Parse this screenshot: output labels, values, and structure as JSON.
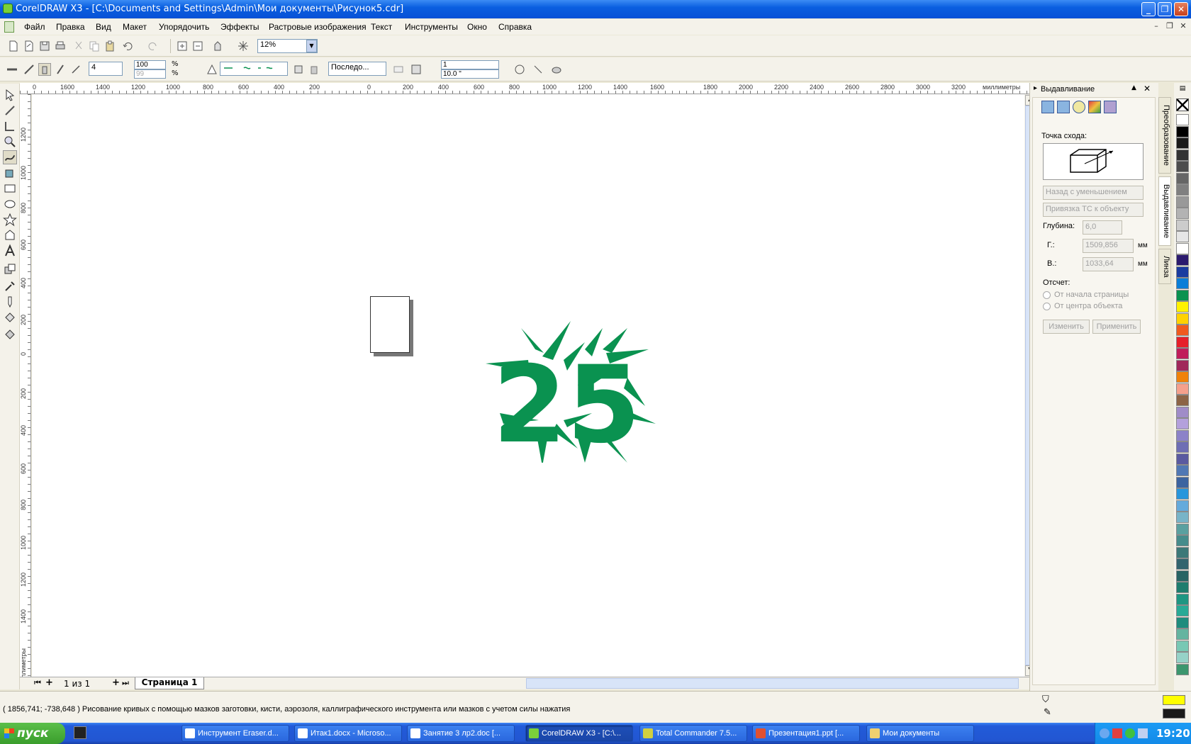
{
  "window": {
    "title": "CorelDRAW X3 - [C:\\Documents and Settings\\Admin\\Мои документы\\Рисунок5.cdr]"
  },
  "menu": [
    "Файл",
    "Правка",
    "Вид",
    "Макет",
    "Упорядочить",
    "Эффекты",
    "Растровые изображения",
    "Текст",
    "Инструменты",
    "Окно",
    "Справка"
  ],
  "toolbar1": {
    "zoom": "12%"
  },
  "toolbar2": {
    "width_value": "4",
    "size_top": "100",
    "size_bottom": "99",
    "percent1": "%",
    "percent2": "%",
    "mode_select": "Последо...",
    "spin_top": "1",
    "spin_bottom": "10.0 \""
  },
  "ruler": {
    "h_ticks": [
      "0",
      "1600",
      "1400",
      "1200",
      "1000",
      "800",
      "600",
      "400",
      "200",
      "0",
      "200",
      "400",
      "600",
      "800",
      "1000",
      "1200",
      "1400",
      "1600",
      "1800",
      "2000",
      "2200",
      "2400",
      "2600",
      "2800",
      "3000",
      "3200"
    ],
    "h_unit": "миллиметры",
    "v_ticks": [
      "1200",
      "1000",
      "800",
      "600",
      "400",
      "200",
      "0",
      "200",
      "400",
      "600",
      "800",
      "1000",
      "1200",
      "1400"
    ],
    "v_unit": "миллиметры"
  },
  "canvas": {
    "artwork_text": "25",
    "artwork_color": "#0a9250"
  },
  "pagebar": {
    "page_count": "1 из 1",
    "page_tab": "Страница 1"
  },
  "docker": {
    "title": "Выдавливание",
    "vanishing_label": "Точка схода:",
    "dropdown1": "Назад с уменьшением",
    "dropdown2": "Привязка ТС к объекту",
    "depth_label": "Глубина:",
    "depth_value": "6,0",
    "h_label": "Г.:",
    "h_value": "1509,856",
    "v_label": "В.:",
    "v_value": "1033,64",
    "unit": "мм",
    "offset_label": "Отсчет:",
    "radio1": "От начала страницы",
    "radio2": "От центра объекта",
    "btn_change": "Изменить",
    "btn_apply": "Применить"
  },
  "vtabs": [
    "Преобразование",
    "Выдавливание",
    "Линза"
  ],
  "palette": [
    "#ffffff",
    "#000000",
    "#1a1a1a",
    "#333333",
    "#4d4d4d",
    "#666666",
    "#808080",
    "#999999",
    "#b3b3b3",
    "#cccccc",
    "#e6e6e6",
    "#ffffff",
    "#2b1a6e",
    "#1a3ca0",
    "#0a7ed8",
    "#0a9250",
    "#fff200",
    "#ffd200",
    "#f05a1e",
    "#e6202a",
    "#c01e5a",
    "#a0285a",
    "#f0820a",
    "#f5a08c",
    "#8c6446",
    "#a08cc8",
    "#b4a0dc",
    "#8c82c8",
    "#6e6eb4",
    "#5a5aa0",
    "#5078b4",
    "#3c64a0",
    "#2896dc",
    "#64aadc",
    "#78b4c8",
    "#5aa0a0",
    "#468c8c",
    "#3c7878",
    "#32646e",
    "#286464",
    "#1e7d6e",
    "#1e9682",
    "#28aa96",
    "#1e8c7d",
    "#64b4a0",
    "#78c8b4",
    "#96d2c8",
    "#3c966e"
  ],
  "status": {
    "coords_text": "( 1856,741; -738,648 ) Рисование кривых с помощью мазков заготовки, кисти, аэрозоля, каллиграфического инструмента или мазков с учетом силы нажатия",
    "fill_color": "#ffff00",
    "outline_color": "#1a1a1a"
  },
  "taskbar": {
    "start": "пуск",
    "tasks": [
      "Инструмент Eraser.d...",
      "Итак1.docx - Microso...",
      "Занятие 3 лр2.doc [...",
      "CorelDRAW X3 - [C:\\...",
      "Total Commander 7.5...",
      "Презентация1.ppt [...",
      "Мои документы"
    ],
    "active_index": 3,
    "time": "19:20"
  }
}
